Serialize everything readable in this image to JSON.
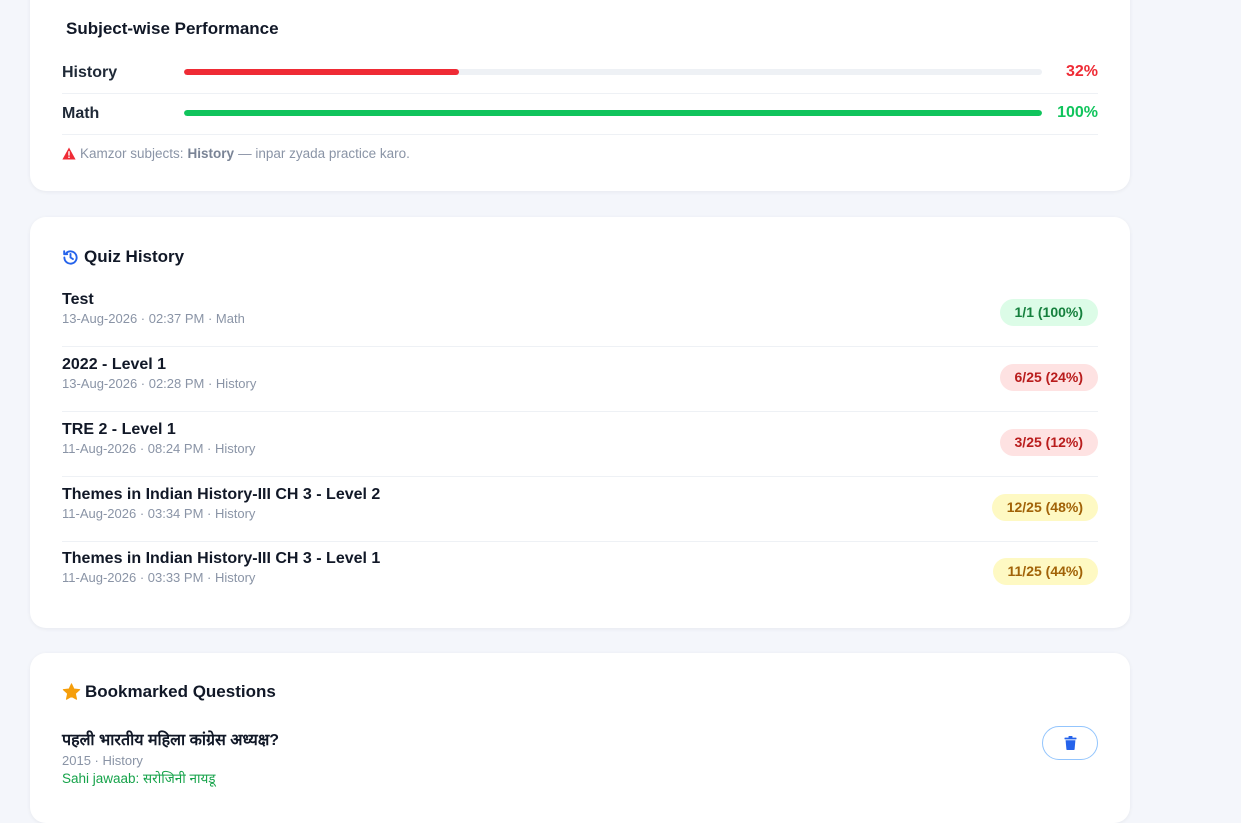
{
  "performance": {
    "title": "Subject-wise Performance",
    "subjects": [
      {
        "name": "History",
        "percent_label": "32%",
        "value": 32,
        "color": "#ef2b35"
      },
      {
        "name": "Math",
        "percent_label": "100%",
        "value": 100,
        "color": "#10c45c"
      }
    ],
    "weak_prefix": "Kamzor subjects:",
    "weak_subjects": "History",
    "weak_suffix": "— inpar zyada practice karo."
  },
  "quiz_history": {
    "title": "Quiz History",
    "items": [
      {
        "name": "Test",
        "meta": "13-Aug-2026 · 02:37 PM · Math",
        "score": "1/1 (100%)",
        "tone": "green"
      },
      {
        "name": "2022 - Level 1",
        "meta": "13-Aug-2026 · 02:28 PM · History",
        "score": "6/25 (24%)",
        "tone": "red"
      },
      {
        "name": "TRE 2 - Level 1",
        "meta": "11-Aug-2026 · 08:24 PM · History",
        "score": "3/25 (12%)",
        "tone": "red"
      },
      {
        "name": "Themes in Indian History-III CH 3 - Level 2",
        "meta": "11-Aug-2026 · 03:34 PM · History",
        "score": "12/25 (48%)",
        "tone": "yellow"
      },
      {
        "name": "Themes in Indian History-III CH 3 - Level 1",
        "meta": "11-Aug-2026 · 03:33 PM · History",
        "score": "11/25 (44%)",
        "tone": "yellow"
      }
    ]
  },
  "bookmarks": {
    "title": "Bookmarked Questions",
    "items": [
      {
        "question": "पहली भारतीय महिला कांग्रेस अध्यक्ष?",
        "meta": "2015 · History",
        "answer": "Sahi jawaab: सरोजिनी नायडू"
      }
    ]
  },
  "icons": {
    "warning": "warning-triangle-icon",
    "history": "history-clock-icon",
    "star": "star-icon",
    "trash": "trash-icon"
  },
  "colors": {
    "red": "#ef2b35",
    "green": "#10c45c",
    "accent_blue": "#2563eb",
    "star_orange": "#f59e0b"
  }
}
